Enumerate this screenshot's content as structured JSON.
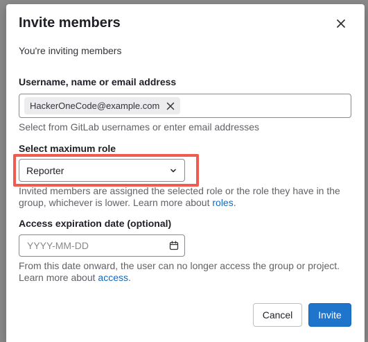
{
  "modal": {
    "title": "Invite members",
    "intro": "You're inviting members"
  },
  "username": {
    "label": "Username, name or email address",
    "token": "HackerOneCode@example.com",
    "help": "Select from GitLab usernames or enter email addresses"
  },
  "role": {
    "label": "Select maximum role",
    "selected": "Reporter",
    "help_text": "Invited members are assigned the selected role or the role they have in the group, whichever is lower. Learn more about ",
    "help_link": "roles",
    "help_end": "."
  },
  "expiration": {
    "label": "Access expiration date (optional)",
    "placeholder": "YYYY-MM-DD",
    "help_text": "From this date onward, the user can no longer access the group or project. Learn more about ",
    "help_link": "access",
    "help_end": "."
  },
  "buttons": {
    "cancel": "Cancel",
    "invite": "Invite"
  },
  "colors": {
    "primary": "#1f75cb",
    "link": "#1068bf",
    "highlight": "#f05a4f"
  }
}
